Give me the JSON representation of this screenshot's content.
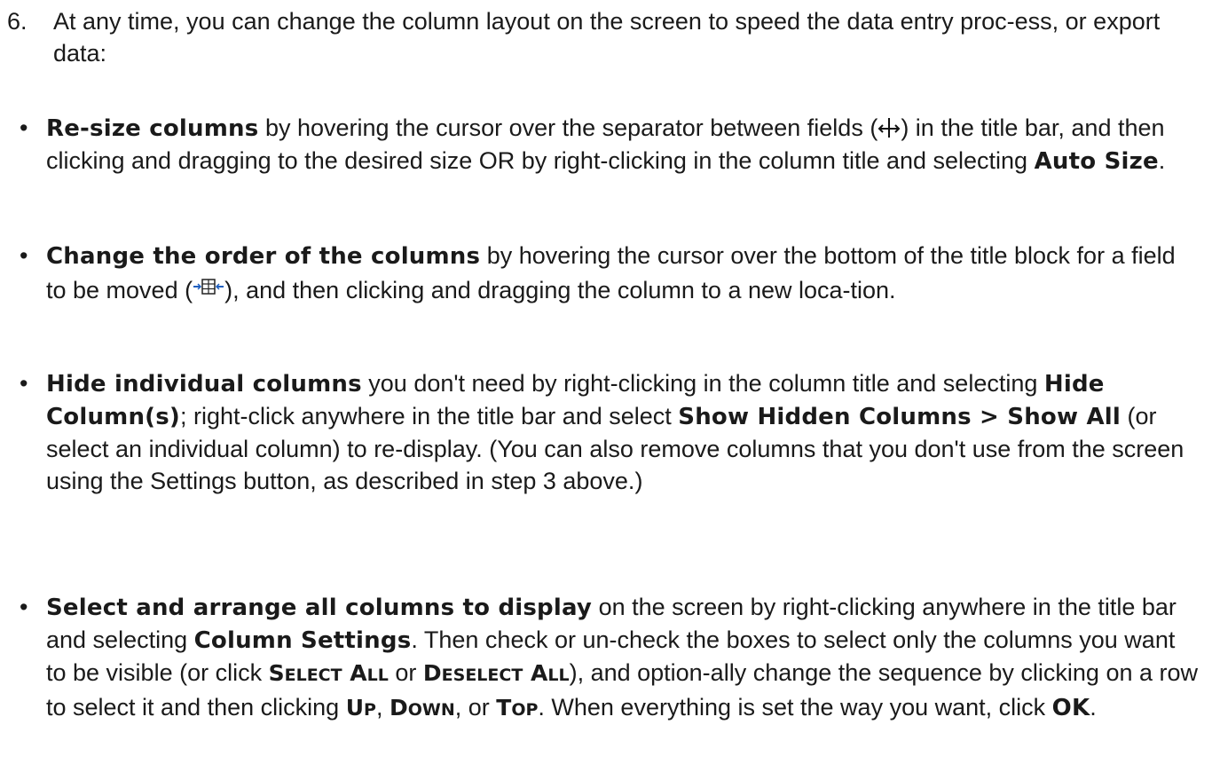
{
  "step": {
    "number": "6.",
    "text": "At any time, you can change the column layout on the screen to speed the data entry proc-ess, or export data:"
  },
  "bullets": [
    {
      "bold_lead": "Re-size columns",
      "t1": " by hovering the cursor over the separator between fields (",
      "icon": "column-resize-cursor-icon",
      "t2": ") in the title bar, and then clicking and dragging to the desired size OR by right-clicking in the column title and selecting ",
      "bold_1": "Auto Size",
      "t3": "."
    },
    {
      "bold_lead": "Change the order of the columns",
      "t1": " by hovering the cursor over the bottom of the title block for a field to be moved (",
      "icon": "column-move-cursor-icon",
      "t2": "), and then clicking and dragging the column to a new loca-tion."
    },
    {
      "bold_lead": "Hide individual columns",
      "t1": " you don't need by right-clicking in the column title and selecting ",
      "bold_1": "Hide Column(s)",
      "t2": "; right-click anywhere in the title bar and select ",
      "bold_2": "Show Hidden Columns > Show All",
      "t3": " (or select an individual column) to re-display. (You can also remove columns that you don't use from the screen using the Settings button, as described in step 3 above.)"
    },
    {
      "bold_lead": "Select and arrange all columns to display",
      "t1": " on the screen by right-clicking anywhere in the title bar and selecting ",
      "bold_1": "Column Settings",
      "t2": ". Then check or un-check the boxes to select only the columns you want to be visible (or click ",
      "sc_select_all_a": "S",
      "sc_select_all_b": "ELECT",
      "sc_select_all_c": " A",
      "sc_select_all_d": "LL",
      "t_or": " or ",
      "sc_deselect_all_a": "D",
      "sc_deselect_all_b": "ESELECT",
      "sc_deselect_all_c": " A",
      "sc_deselect_all_d": "LL",
      "t3": "), and option-ally change the sequence by clicking on a row to select it and then clicking ",
      "sc_up_a": "U",
      "sc_up_b": "P",
      "t_comma1": ", ",
      "sc_down_a": "D",
      "sc_down_b": "OWN",
      "t_comma_or": ", or ",
      "sc_top_a": "T",
      "sc_top_b": "OP",
      "t4": ". When everything is set the way you want, click ",
      "bold_ok": "OK",
      "t5": "."
    }
  ],
  "bullet_glyph": "•"
}
